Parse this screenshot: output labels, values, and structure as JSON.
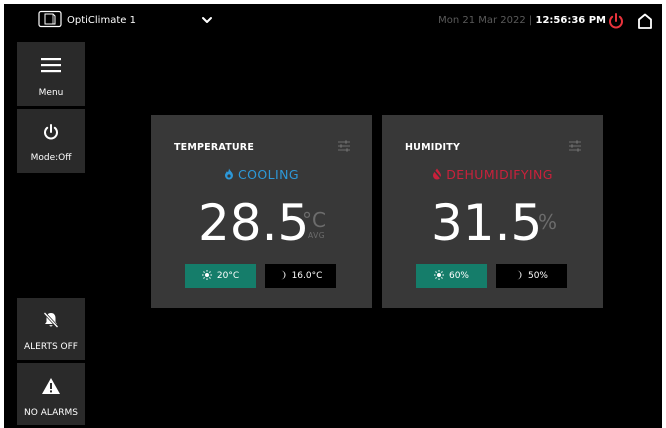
{
  "header": {
    "device_name": "OptiClimate 1",
    "date": "Mon 21 Mar 2022 |",
    "time": "12:56:36 PM",
    "power_color": "#e8333c"
  },
  "sidebar": {
    "menu_label": "Menu",
    "mode_label": "Mode:Off",
    "alerts_label": "ALERTS OFF",
    "alarms_label": "NO ALARMS"
  },
  "temperature": {
    "title": "TEMPERATURE",
    "state": "COOLING",
    "state_color": "#2d98d8",
    "value": "28.5",
    "unit": "°C",
    "avg": "AVG",
    "day_setpoint": "20°C",
    "night_setpoint": "16.0°C"
  },
  "humidity": {
    "title": "HUMIDITY",
    "state": "DEHUMIDIFYING",
    "state_color": "#c9213b",
    "value": "31.5",
    "unit": "%",
    "day_setpoint": "60%",
    "night_setpoint": "50%"
  }
}
